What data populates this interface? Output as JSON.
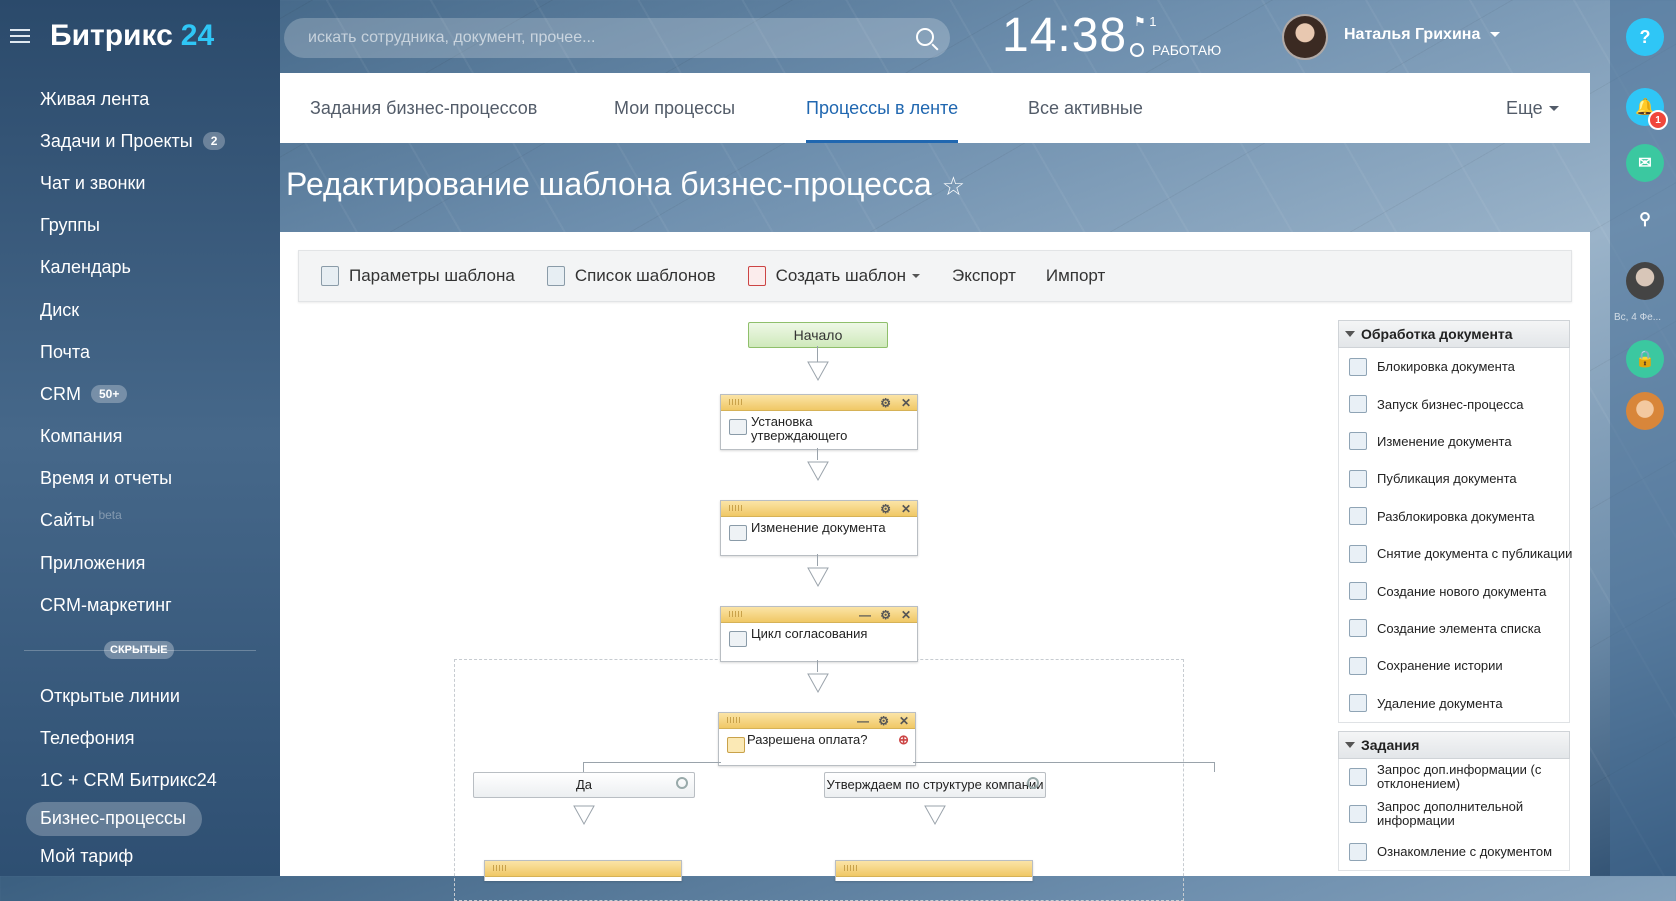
{
  "brand": {
    "name": "Битрикс",
    "num": "24"
  },
  "sidebar": {
    "items": [
      {
        "label": "Живая лента"
      },
      {
        "label": "Задачи и Проекты",
        "badge": "2"
      },
      {
        "label": "Чат и звонки"
      },
      {
        "label": "Группы"
      },
      {
        "label": "Календарь"
      },
      {
        "label": "Диск"
      },
      {
        "label": "Почта"
      },
      {
        "label": "CRM",
        "badge": "50+"
      },
      {
        "label": "Компания"
      },
      {
        "label": "Время и отчеты"
      },
      {
        "label": "Сайты",
        "tag": "beta"
      },
      {
        "label": "Приложения"
      },
      {
        "label": "CRM-маркетинг"
      }
    ],
    "hidden_label": "СКРЫТЫЕ",
    "items2": [
      {
        "label": "Открытые линии"
      },
      {
        "label": "Телефония"
      },
      {
        "label": "1С + CRM Битрикс24"
      },
      {
        "label": "Бизнес-процессы"
      },
      {
        "label": "Мой тариф"
      }
    ]
  },
  "header": {
    "search_placeholder": "искать сотрудника, документ, прочее...",
    "clock": "14:38",
    "flag_count": "1",
    "status": "РАБОТАЮ",
    "user_name": "Наталья Грихина"
  },
  "rightbar": {
    "help": "?",
    "notif_count": "1",
    "date": "Вс, 4 Фе..."
  },
  "tabs": [
    {
      "label": "Задания бизнес-процессов"
    },
    {
      "label": "Мои процессы"
    },
    {
      "label": "Процессы в ленте"
    },
    {
      "label": "Все активные"
    },
    {
      "label": "Еще"
    }
  ],
  "page_title": "Редактирование шаблона бизнес-процесса",
  "toolbar": {
    "params": "Параметры шаблона",
    "list": "Список шаблонов",
    "create": "Создать шаблон",
    "export": "Экспорт",
    "import": "Импорт"
  },
  "workflow": {
    "start": "Начало",
    "n1": "Установка утверждающего",
    "n2": "Изменение документа",
    "n3": "Цикл согласования",
    "n4": "Разрешена оплата?",
    "yes": "Да",
    "branch2": "Утверждаем по структуре компании"
  },
  "palette": {
    "group1": "Обработка документа",
    "items1": [
      "Блокировка документа",
      "Запуск бизнес-процесса",
      "Изменение документа",
      "Публикация документа",
      "Разблокировка документа",
      "Снятие документа с публикации",
      "Создание нового документа",
      "Создание элемента списка",
      "Сохранение истории",
      "Удаление документа"
    ],
    "group2": "Задания",
    "items2": [
      "Запрос доп.информации (с отклонением)",
      "Запрос дополнительной информации",
      "Ознакомление с документом"
    ]
  },
  "colors": {
    "accent": "#2067b0",
    "brand_num": "#2fc6f6",
    "node_head": "#f0c866"
  }
}
